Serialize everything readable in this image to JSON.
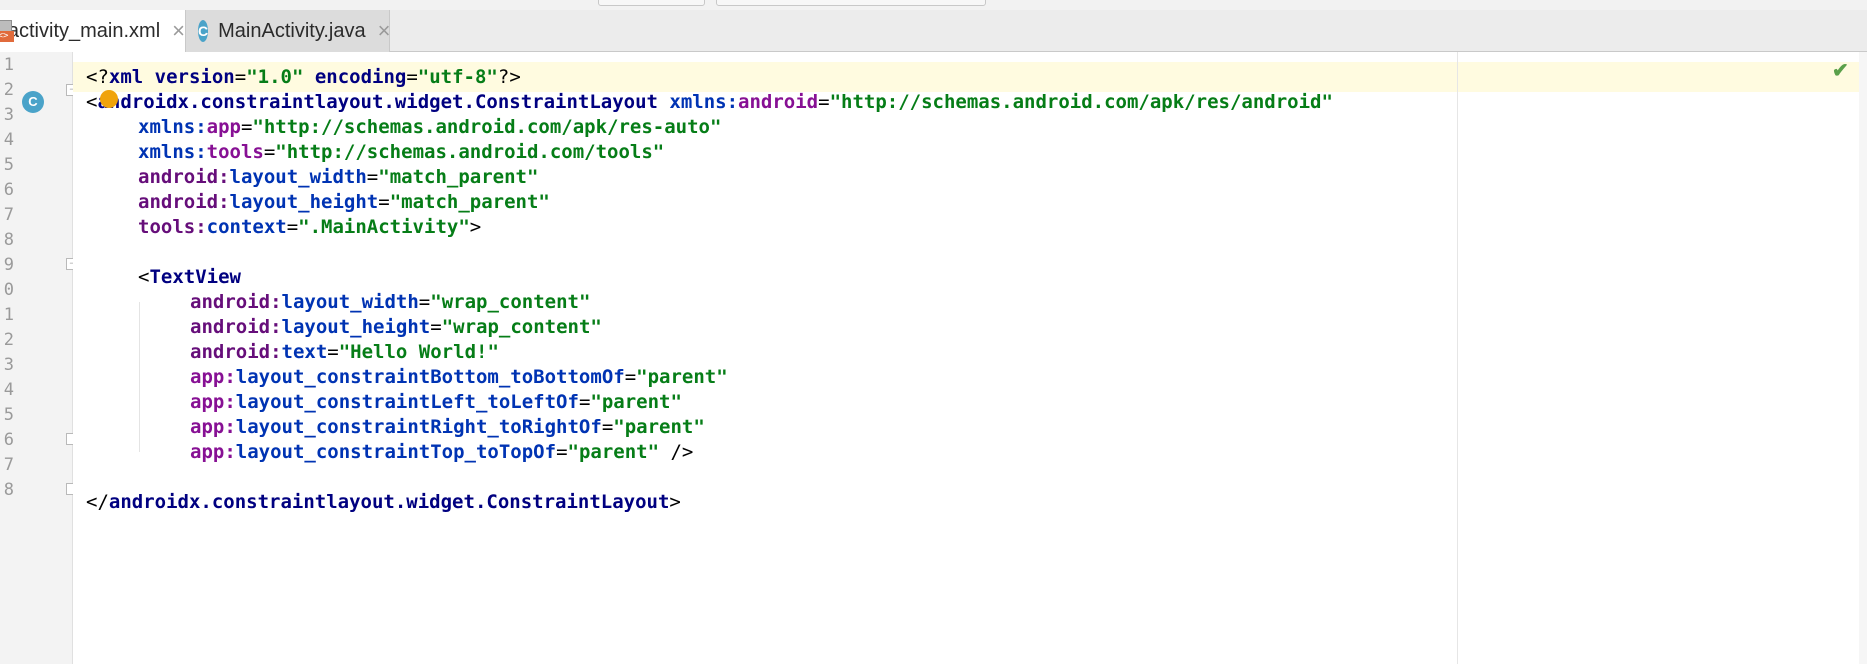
{
  "tabs": [
    {
      "label": "activity_main.xml",
      "close": "×",
      "icon": "xml-file-icon",
      "badge": "<>"
    },
    {
      "label": "MainActivity.java",
      "close": "×",
      "icon": "class-icon",
      "icon_text": "C"
    }
  ],
  "gutter": {
    "class_marker": "C"
  },
  "line_numbers": [
    "1",
    "2",
    "3",
    "4",
    "5",
    "6",
    "7",
    "8",
    "9",
    "0",
    "1",
    "2",
    "3",
    "4",
    "5",
    "6",
    "7",
    "8"
  ],
  "code": {
    "l1": {
      "a": "<?",
      "b": "xml version",
      "c": "=",
      "d": "\"1.0\"",
      "e": " encoding",
      "f": "=",
      "g": "\"utf-8\"",
      "h": "?>"
    },
    "l2": {
      "a": "<",
      "b": "androidx.constraintlayout.widget.ConstraintLayout",
      "c": " xmlns:",
      "d": "android",
      "e": "=",
      "f": "\"http://schemas.android.com/apk/res/android\""
    },
    "l3": {
      "a": "xmlns:",
      "b": "app",
      "c": "=",
      "d": "\"http://schemas.android.com/apk/res-auto\""
    },
    "l4": {
      "a": "xmlns:",
      "b": "tools",
      "c": "=",
      "d": "\"http://schemas.android.com/tools\""
    },
    "l5": {
      "a": "android:",
      "b": "layout_width",
      "c": "=",
      "d": "\"match_parent\""
    },
    "l6": {
      "a": "android:",
      "b": "layout_height",
      "c": "=",
      "d": "\"match_parent\""
    },
    "l7": {
      "a": "tools:",
      "b": "context",
      "c": "=",
      "d": "\".MainActivity\"",
      "e": ">"
    },
    "l9": {
      "a": "<",
      "b": "TextView"
    },
    "l10": {
      "a": "android:",
      "b": "layout_width",
      "c": "=",
      "d": "\"wrap_content\""
    },
    "l11": {
      "a": "android:",
      "b": "layout_height",
      "c": "=",
      "d": "\"wrap_content\""
    },
    "l12": {
      "a": "android:",
      "b": "text",
      "c": "=",
      "d": "\"Hello World!\""
    },
    "l13": {
      "a": "app:",
      "b": "layout_constraintBottom_toBottomOf",
      "c": "=",
      "d": "\"parent\""
    },
    "l14": {
      "a": "app:",
      "b": "layout_constraintLeft_toLeftOf",
      "c": "=",
      "d": "\"parent\""
    },
    "l15": {
      "a": "app:",
      "b": "layout_constraintRight_toRightOf",
      "c": "=",
      "d": "\"parent\""
    },
    "l16": {
      "a": "app:",
      "b": "layout_constraintTop_toTopOf",
      "c": "=",
      "d": "\"parent\"",
      "e": " />"
    },
    "l18": {
      "a": "</",
      "b": "androidx.constraintlayout.widget.ConstraintLayout",
      "c": ">"
    }
  },
  "status": {
    "check": "✔"
  },
  "colors": {
    "tag": "#000080",
    "attr_ns": "#660e7a",
    "value": "#067d17",
    "caret_line": "#fffbe0",
    "icon_badge": "#e16b3c",
    "class_icon": "#4aa3c9"
  }
}
